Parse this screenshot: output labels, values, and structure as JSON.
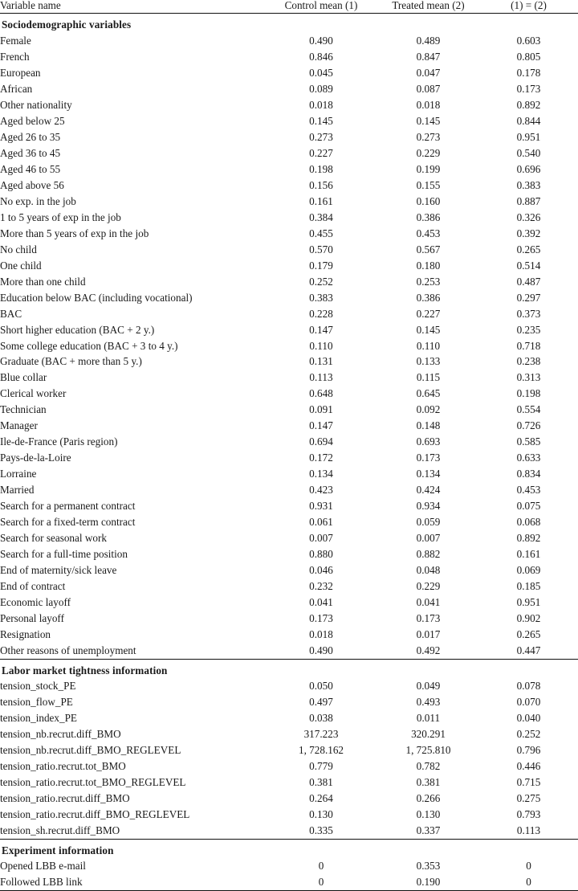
{
  "table": {
    "columns": [
      {
        "key": "name",
        "label": "Variable name",
        "align": "left"
      },
      {
        "key": "ctrl",
        "label": "Control mean (1)",
        "align": "center"
      },
      {
        "key": "trt",
        "label": "Treated mean (2)",
        "align": "center"
      },
      {
        "key": "pval",
        "label": "(1) = (2)",
        "align": "center"
      }
    ],
    "sections": [
      {
        "title": "Sociodemographic variables",
        "rows": [
          {
            "name": "Female",
            "ctrl": "0.490",
            "trt": "0.489",
            "pval": "0.603"
          },
          {
            "name": "French",
            "ctrl": "0.846",
            "trt": "0.847",
            "pval": "0.805"
          },
          {
            "name": "European",
            "ctrl": "0.045",
            "trt": "0.047",
            "pval": "0.178"
          },
          {
            "name": "African",
            "ctrl": "0.089",
            "trt": "0.087",
            "pval": "0.173"
          },
          {
            "name": "Other nationality",
            "ctrl": "0.018",
            "trt": "0.018",
            "pval": "0.892"
          },
          {
            "name": "Aged below 25",
            "ctrl": "0.145",
            "trt": "0.145",
            "pval": "0.844"
          },
          {
            "name": "Aged 26 to 35",
            "ctrl": "0.273",
            "trt": "0.273",
            "pval": "0.951"
          },
          {
            "name": "Aged 36 to 45",
            "ctrl": "0.227",
            "trt": "0.229",
            "pval": "0.540"
          },
          {
            "name": "Aged 46 to 55",
            "ctrl": "0.198",
            "trt": "0.199",
            "pval": "0.696"
          },
          {
            "name": "Aged above 56",
            "ctrl": "0.156",
            "trt": "0.155",
            "pval": "0.383"
          },
          {
            "name": "No exp. in the job",
            "ctrl": "0.161",
            "trt": "0.160",
            "pval": "0.887"
          },
          {
            "name": "1 to 5 years of exp in the job",
            "ctrl": "0.384",
            "trt": "0.386",
            "pval": "0.326"
          },
          {
            "name": "More than 5 years of exp in the job",
            "ctrl": "0.455",
            "trt": "0.453",
            "pval": "0.392"
          },
          {
            "name": "No child",
            "ctrl": "0.570",
            "trt": "0.567",
            "pval": "0.265"
          },
          {
            "name": "One child",
            "ctrl": "0.179",
            "trt": "0.180",
            "pval": "0.514"
          },
          {
            "name": "More than one child",
            "ctrl": "0.252",
            "trt": "0.253",
            "pval": "0.487"
          },
          {
            "name": "Education below BAC (including vocational)",
            "ctrl": "0.383",
            "trt": "0.386",
            "pval": "0.297"
          },
          {
            "name": "BAC",
            "ctrl": "0.228",
            "trt": "0.227",
            "pval": "0.373"
          },
          {
            "name": "Short higher education (BAC + 2 y.)",
            "ctrl": "0.147",
            "trt": "0.145",
            "pval": "0.235"
          },
          {
            "name": "Some college education (BAC + 3 to 4 y.)",
            "ctrl": "0.110",
            "trt": "0.110",
            "pval": "0.718"
          },
          {
            "name": "Graduate (BAC + more than 5 y.)",
            "ctrl": "0.131",
            "trt": "0.133",
            "pval": "0.238"
          },
          {
            "name": "Blue collar",
            "ctrl": "0.113",
            "trt": "0.115",
            "pval": "0.313"
          },
          {
            "name": "Clerical worker",
            "ctrl": "0.648",
            "trt": "0.645",
            "pval": "0.198"
          },
          {
            "name": "Technician",
            "ctrl": "0.091",
            "trt": "0.092",
            "pval": "0.554"
          },
          {
            "name": "Manager",
            "ctrl": "0.147",
            "trt": "0.148",
            "pval": "0.726"
          },
          {
            "name": "Ile-de-France (Paris region)",
            "ctrl": "0.694",
            "trt": "0.693",
            "pval": "0.585"
          },
          {
            "name": "Pays-de-la-Loire",
            "ctrl": "0.172",
            "trt": "0.173",
            "pval": "0.633"
          },
          {
            "name": "Lorraine",
            "ctrl": "0.134",
            "trt": "0.134",
            "pval": "0.834"
          },
          {
            "name": "Married",
            "ctrl": "0.423",
            "trt": "0.424",
            "pval": "0.453"
          },
          {
            "name": "Search for a permanent contract",
            "ctrl": "0.931",
            "trt": "0.934",
            "pval": "0.075"
          },
          {
            "name": "Search for a fixed-term contract",
            "ctrl": "0.061",
            "trt": "0.059",
            "pval": "0.068"
          },
          {
            "name": "Search for seasonal work",
            "ctrl": "0.007",
            "trt": "0.007",
            "pval": "0.892"
          },
          {
            "name": "Search for a full-time position",
            "ctrl": "0.880",
            "trt": "0.882",
            "pval": "0.161"
          },
          {
            "name": "End of maternity/sick leave",
            "ctrl": "0.046",
            "trt": "0.048",
            "pval": "0.069"
          },
          {
            "name": "End of contract",
            "ctrl": "0.232",
            "trt": "0.229",
            "pval": "0.185"
          },
          {
            "name": "Economic layoff",
            "ctrl": "0.041",
            "trt": "0.041",
            "pval": "0.951"
          },
          {
            "name": "Personal layoff",
            "ctrl": "0.173",
            "trt": "0.173",
            "pval": "0.902"
          },
          {
            "name": "Resignation",
            "ctrl": "0.018",
            "trt": "0.017",
            "pval": "0.265"
          },
          {
            "name": "Other reasons of unemployment",
            "ctrl": "0.490",
            "trt": "0.492",
            "pval": "0.447"
          }
        ]
      },
      {
        "title": "Labor market tightness information",
        "rows": [
          {
            "name": "tension_stock_PE",
            "ctrl": "0.050",
            "trt": "0.049",
            "pval": "0.078"
          },
          {
            "name": "tension_flow_PE",
            "ctrl": "0.497",
            "trt": "0.493",
            "pval": "0.070"
          },
          {
            "name": "tension_index_PE",
            "ctrl": "0.038",
            "trt": "0.011",
            "pval": "0.040"
          },
          {
            "name": "tension_nb.recrut.diff_BMO",
            "ctrl": "317.223",
            "trt": "320.291",
            "pval": "0.252"
          },
          {
            "name": "tension_nb.recrut.diff_BMO_REGLEVEL",
            "ctrl": "1, 728.162",
            "trt": "1, 725.810",
            "pval": "0.796"
          },
          {
            "name": "tension_ratio.recrut.tot_BMO",
            "ctrl": "0.779",
            "trt": "0.782",
            "pval": "0.446"
          },
          {
            "name": "tension_ratio.recrut.tot_BMO_REGLEVEL",
            "ctrl": "0.381",
            "trt": "0.381",
            "pval": "0.715"
          },
          {
            "name": "tension_ratio.recrut.diff_BMO",
            "ctrl": "0.264",
            "trt": "0.266",
            "pval": "0.275"
          },
          {
            "name": "tension_ratio.recrut.diff_BMO_REGLEVEL",
            "ctrl": "0.130",
            "trt": "0.130",
            "pval": "0.793"
          },
          {
            "name": "tension_sh.recrut.diff_BMO",
            "ctrl": "0.335",
            "trt": "0.337",
            "pval": "0.113"
          }
        ]
      },
      {
        "title": "Experiment information",
        "rows": [
          {
            "name": "Opened LBB e-mail",
            "ctrl": "0",
            "trt": "0.353",
            "pval": "0"
          },
          {
            "name": "Followed LBB link",
            "ctrl": "0",
            "trt": "0.190",
            "pval": "0"
          }
        ]
      }
    ]
  }
}
